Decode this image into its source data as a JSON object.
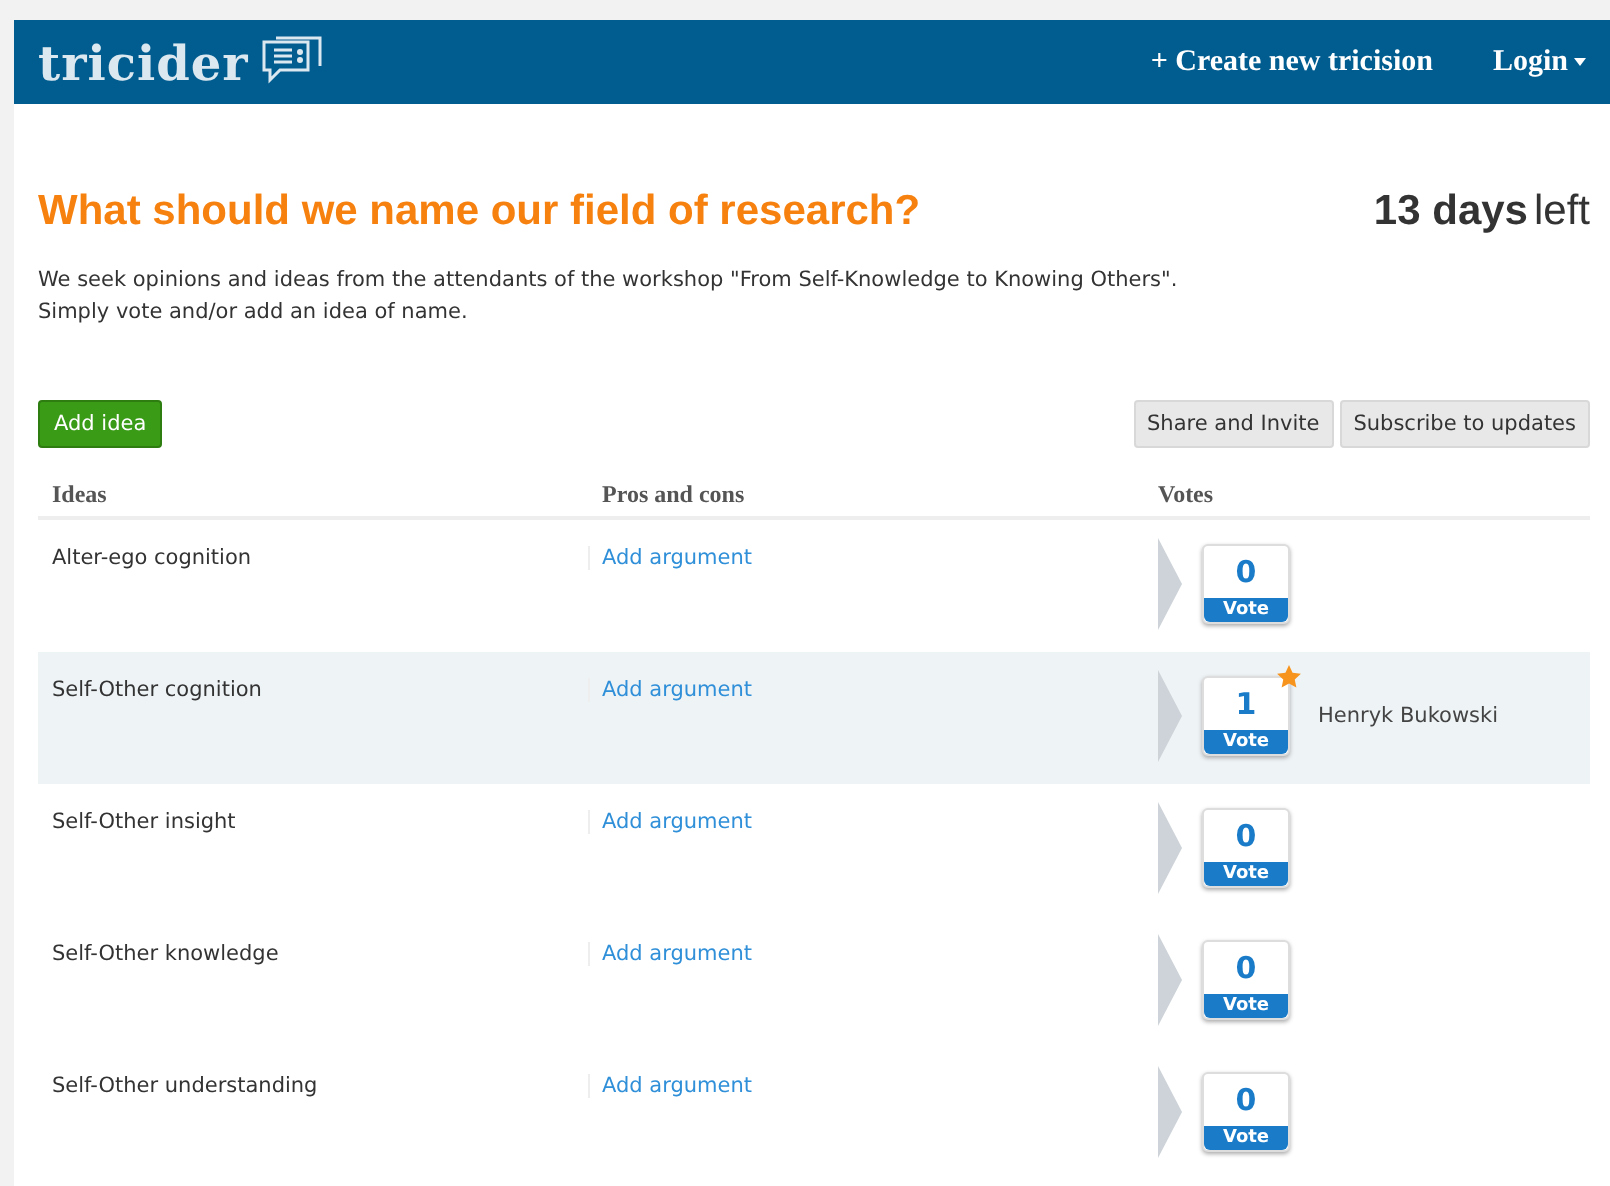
{
  "header": {
    "logo": "tricider",
    "create_link": "+ Create new tricision",
    "login": "Login"
  },
  "question": {
    "title": "What should we name our field of research?",
    "days_count": "13 days",
    "days_suffix": "left",
    "description": "We seek opinions and ideas from the attendants of the workshop \"From Self-Knowledge to Knowing Others\".",
    "instruction": "Simply vote and/or add an idea of name."
  },
  "actions": {
    "add": "Add idea",
    "share": "Share and Invite",
    "subscribe": "Subscribe to updates"
  },
  "table": {
    "columns": [
      "Ideas",
      "Pros and cons",
      "Votes"
    ],
    "rows": [
      {
        "idea": "Alter-ego cognition",
        "argument": "Add argument",
        "votes": "0",
        "vote_label": "Vote",
        "highlighted": false,
        "starred": false,
        "voters": []
      },
      {
        "idea": "Self-Other cognition",
        "argument": "Add argument",
        "votes": "1",
        "vote_label": "Vote",
        "highlighted": true,
        "starred": true,
        "voters": [
          "Henryk Bukowski"
        ]
      },
      {
        "idea": "Self-Other insight",
        "argument": "Add argument",
        "votes": "0",
        "vote_label": "Vote",
        "highlighted": false,
        "starred": false,
        "voters": []
      },
      {
        "idea": "Self-Other knowledge",
        "argument": "Add argument",
        "votes": "0",
        "vote_label": "Vote",
        "highlighted": false,
        "starred": false,
        "voters": []
      },
      {
        "idea": "Self-Other understanding",
        "argument": "Add argument",
        "votes": "0",
        "vote_label": "Vote",
        "highlighted": false,
        "starred": false,
        "voters": []
      }
    ]
  }
}
